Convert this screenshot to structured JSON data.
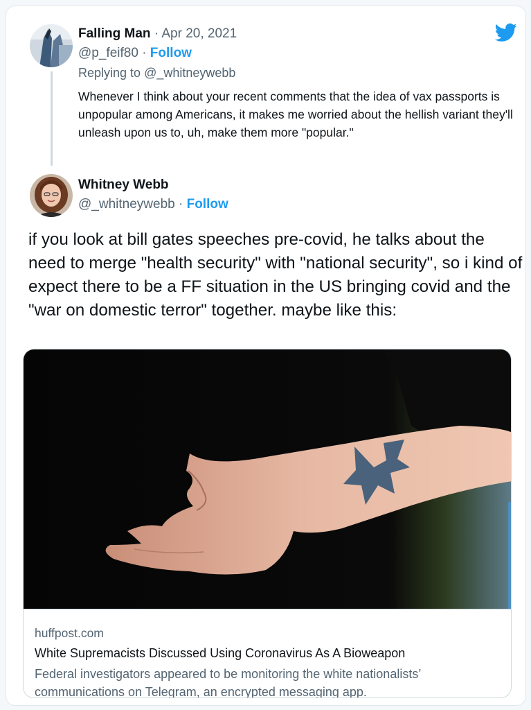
{
  "reply_tweet": {
    "name": "Falling Man",
    "separator": "·",
    "date": "Apr 20, 2021",
    "handle": "@p_feif80",
    "follow_label": "Follow",
    "replying_to_prefix": "Replying to",
    "replying_to_handle": "@_whitneywebb",
    "text": "Whenever I think about your recent comments that the idea of vax passports is unpopular among Americans, it makes me worried about the hellish variant they'll unleash upon us to, uh, make them more \"popular.\""
  },
  "main_tweet": {
    "name": "Whitney Webb",
    "handle": "@_whitneywebb",
    "separator": "·",
    "follow_label": "Follow",
    "text": "if you look at bill gates speeches pre-covid, he talks about the need to merge \"health security\" with \"national security\", so i kind of expect there to be a FF situation in the US bringing covid and the \"war on domestic terror\" together. maybe like this:"
  },
  "link_card": {
    "image": "arm-with-iron-cross-tattoo-photo",
    "domain": "huffpost.com",
    "title": "White Supremacists Discussed Using Coronavirus As A Bioweapon",
    "description": "Federal investigators appeared to be monitoring the white nationalists’ communications on Telegram, an encrypted messaging app."
  },
  "icons": {
    "brand": "twitter-bird-icon"
  },
  "colors": {
    "accent": "#1d9bf0",
    "text": "#0f1419",
    "muted": "#536471",
    "border": "#cfd9de"
  }
}
